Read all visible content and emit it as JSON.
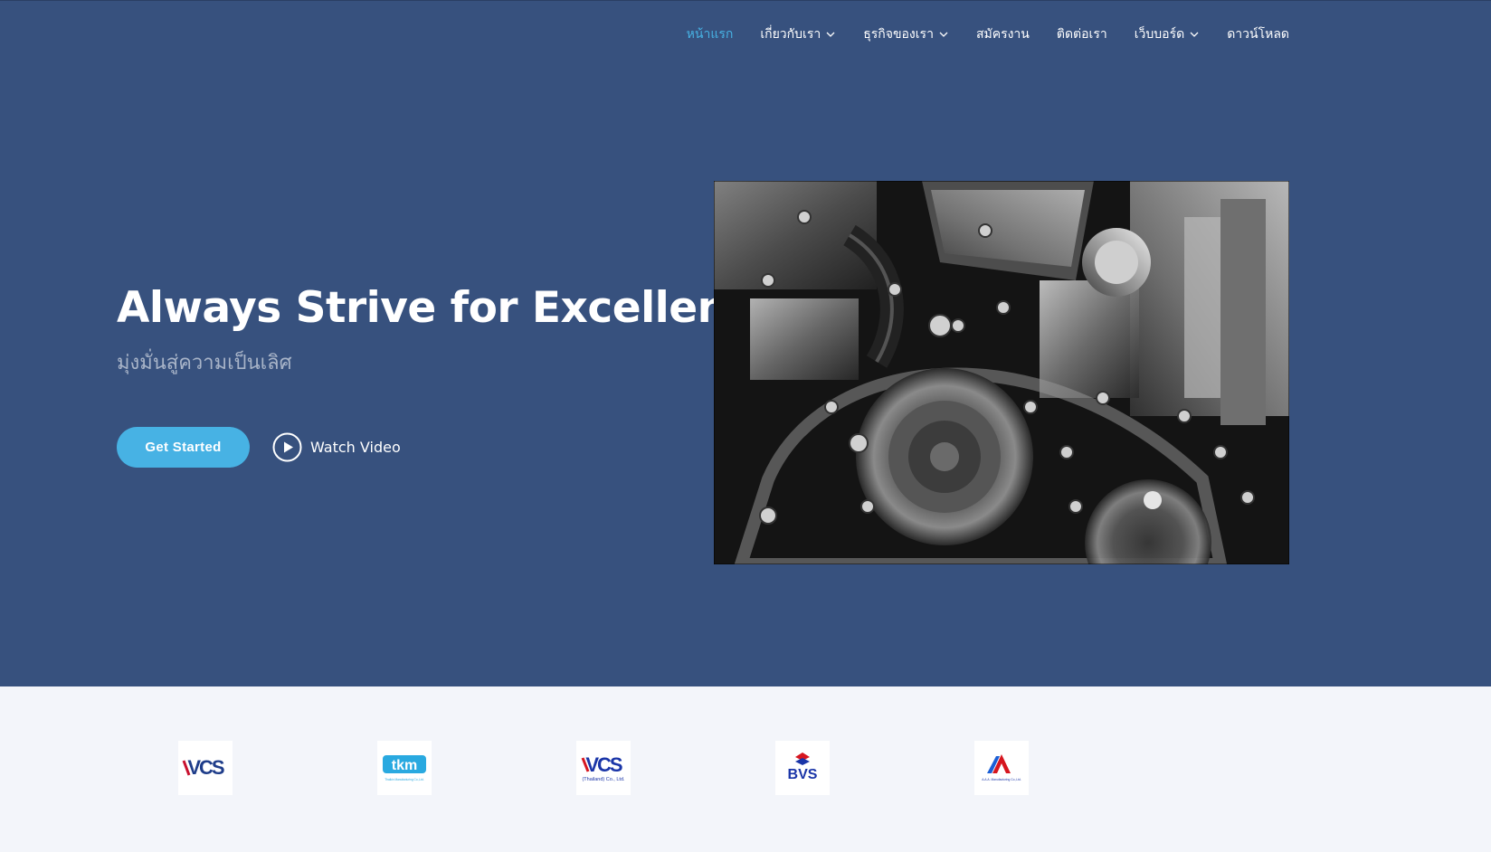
{
  "nav": {
    "items": [
      {
        "label": "หน้าแรก",
        "active": true,
        "dropdown": false
      },
      {
        "label": "เกี่ยวกับเรา",
        "active": false,
        "dropdown": true
      },
      {
        "label": "ธุรกิจของเรา",
        "active": false,
        "dropdown": true
      },
      {
        "label": "สมัครงาน",
        "active": false,
        "dropdown": false
      },
      {
        "label": "ติดต่อเรา",
        "active": false,
        "dropdown": false
      },
      {
        "label": "เว็บบอร์ด",
        "active": false,
        "dropdown": true
      },
      {
        "label": "ดาวน์โหลด",
        "active": false,
        "dropdown": false
      }
    ]
  },
  "hero": {
    "title": "Always Strive for Excellence",
    "subtitle": "มุ่งมั่นสู่ความเป็นเลิศ",
    "cta_label": "Get Started",
    "video_label": "Watch Video",
    "image": "engine-photo"
  },
  "clients": {
    "logos": [
      {
        "name": "VCS",
        "caption": ""
      },
      {
        "name": "tkm",
        "caption": "Thaikin Manufacturing Co.,Ltd."
      },
      {
        "name": "VCS",
        "caption": "(Thailand) Co., Ltd."
      },
      {
        "name": "BVS",
        "caption": ""
      },
      {
        "name": "AAA",
        "caption": "A.A.A. Manufacturing Co.,Ltd."
      }
    ]
  },
  "colors": {
    "hero_bg": "#37517e",
    "accent": "#47b2e4",
    "clients_bg": "#f3f5fa"
  }
}
